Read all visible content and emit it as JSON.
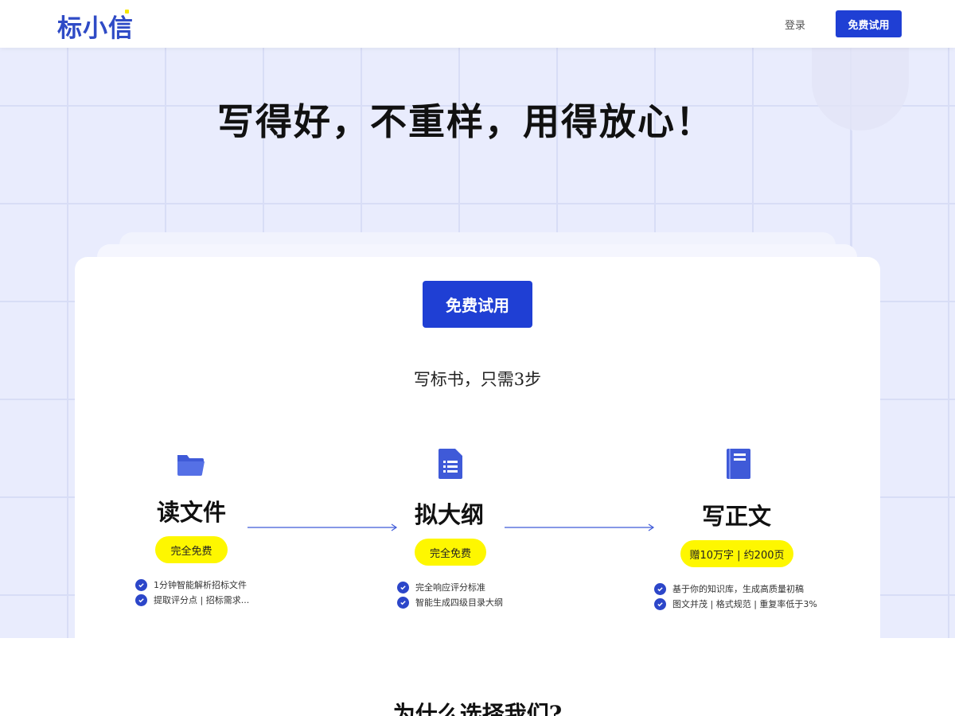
{
  "header": {
    "logo": "标小信",
    "login_label": "登录",
    "trial_label": "免费试用"
  },
  "hero": {
    "title": "写得好，不重样，用得放心！",
    "trial_label": "免费试用",
    "subtitle": "写标书，只需3步"
  },
  "steps": [
    {
      "icon": "folder-icon",
      "title": "读文件",
      "badge": "完全免费",
      "features": [
        "1分钟智能解析招标文件",
        "提取评分点 | 招标需求..."
      ]
    },
    {
      "icon": "document-icon",
      "title": "拟大纲",
      "badge": "完全免费",
      "features": [
        "完全响应评分标准",
        "智能生成四级目录大纲"
      ]
    },
    {
      "icon": "book-icon",
      "title": "写正文",
      "badge": "赠10万字 | 约200页",
      "features": [
        "基于你的知识库，生成高质量初稿",
        "图文并茂 | 格式规范 | 重复率低于3%"
      ]
    }
  ],
  "why": {
    "title": "为什么选择我们?"
  },
  "colors": {
    "brand": "#1f3fd4",
    "badge": "#fef700",
    "hero_bg": "#e9ecfd"
  }
}
